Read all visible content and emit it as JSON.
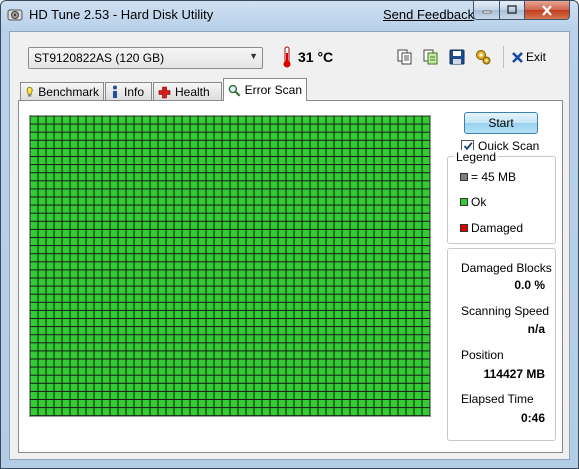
{
  "window": {
    "title": "HD Tune 2.53 - Hard Disk Utility",
    "feedback_label": "Send Feedback"
  },
  "toolbar": {
    "drive": "ST9120822AS (120 GB)",
    "temperature": "31 °C",
    "exit_label": "Exit"
  },
  "tabs": [
    {
      "label": "Benchmark",
      "icon": "benchmark-icon"
    },
    {
      "label": "Info",
      "icon": "info-icon"
    },
    {
      "label": "Health",
      "icon": "health-icon"
    },
    {
      "label": "Error Scan",
      "icon": "error-scan-icon",
      "active": true
    }
  ],
  "scan": {
    "start_label": "Start",
    "quick_scan_label": "Quick Scan",
    "quick_scan_checked": true,
    "block_status": "Ok"
  },
  "legend": {
    "title": "Legend",
    "items": [
      {
        "label": "= 45 MB",
        "color": "#808080"
      },
      {
        "label": "Ok",
        "color": "#33cc33"
      },
      {
        "label": "Damaged",
        "color": "#dd0000"
      }
    ]
  },
  "stats": {
    "damaged_blocks_label": "Damaged Blocks",
    "damaged_blocks_value": "0.0 %",
    "scanning_speed_label": "Scanning Speed",
    "scanning_speed_value": "n/a",
    "position_label": "Position",
    "position_value": "114427 MB",
    "elapsed_label": "Elapsed Time",
    "elapsed_value": "0:46"
  },
  "colors": {
    "ok": "#33cc33",
    "damaged": "#dd0000",
    "grid_line": "#1a1a1a"
  }
}
